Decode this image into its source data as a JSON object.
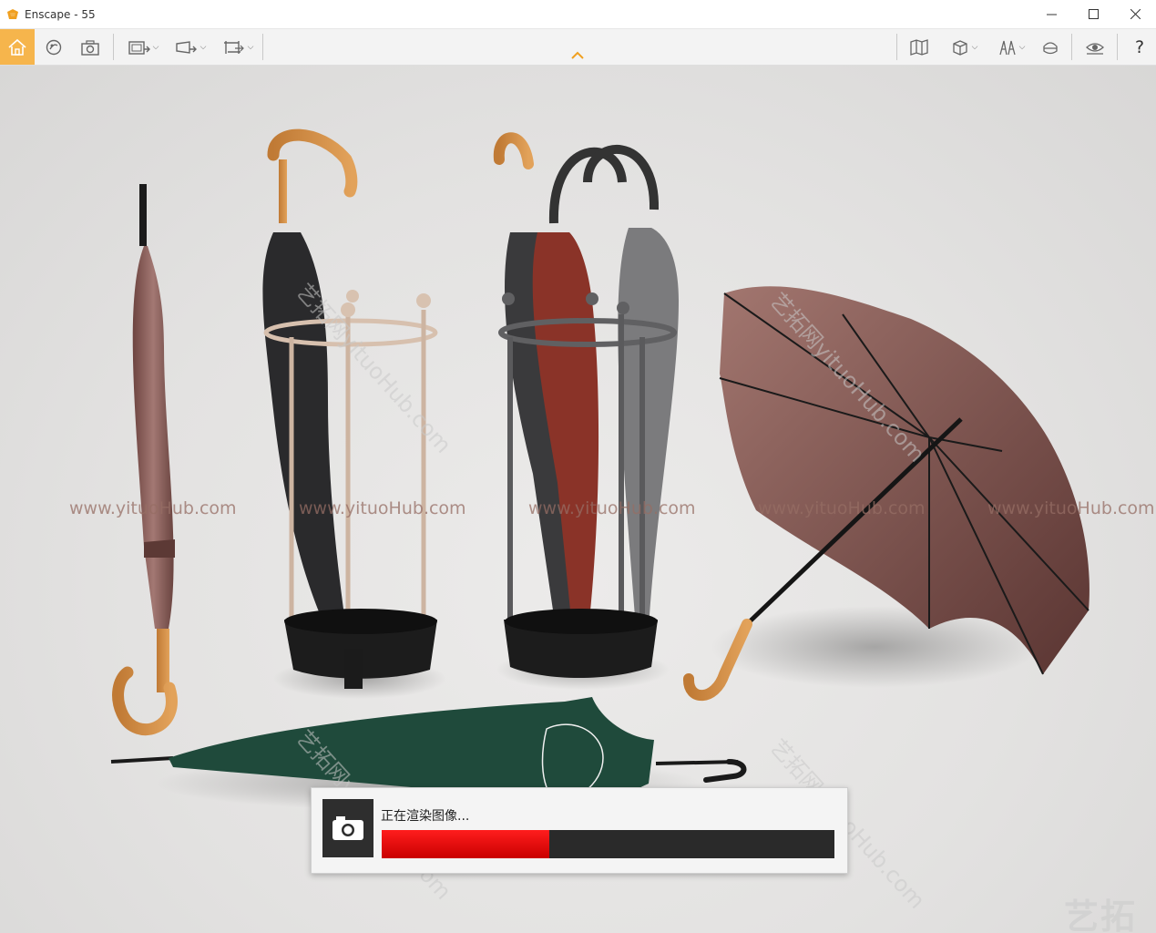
{
  "window": {
    "title": "Enscape - 55",
    "controls": [
      "minimize-icon",
      "maximize-icon",
      "close-icon"
    ]
  },
  "toolbar": {
    "left_items": [
      {
        "name": "home",
        "icon": "home-icon",
        "active": true
      },
      {
        "name": "asset-library",
        "icon": "asset-library-icon"
      },
      {
        "name": "screenshot",
        "icon": "camera-icon"
      },
      {
        "name": "render-image",
        "icon": "render-image-icon",
        "dropdown": true
      },
      {
        "name": "render-video",
        "icon": "render-video-icon",
        "dropdown": true
      },
      {
        "name": "export",
        "icon": "export-icon",
        "dropdown": true
      }
    ],
    "right_items": [
      {
        "name": "map",
        "icon": "map-icon"
      },
      {
        "name": "view-cube",
        "icon": "cube-icon",
        "dropdown": true
      },
      {
        "name": "settings-view",
        "icon": "sliders-icon",
        "dropdown": true
      },
      {
        "name": "vr",
        "icon": "vr-headset-icon"
      },
      {
        "name": "visibility",
        "icon": "eye-icon"
      },
      {
        "name": "help",
        "label": "?"
      }
    ],
    "accent_color": "#f6b54c",
    "collapse_icon": "chevron-up-icon"
  },
  "watermarks": {
    "row_text": "www.yituoHub.com",
    "diagonal_text": "艺拓网yituoHub.com",
    "corner_logo": "艺拓"
  },
  "render_progress": {
    "icon": "camera-icon",
    "status": "正在渲染图像...",
    "progress": 0.37,
    "bar_color": "#e00000"
  }
}
